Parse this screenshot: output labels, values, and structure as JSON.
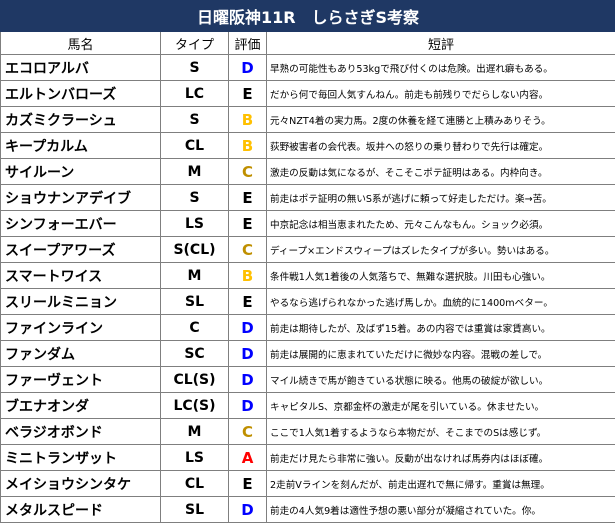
{
  "title": "日曜阪神11R　しらさぎS考察",
  "headers": {
    "name": "馬名",
    "type": "タイプ",
    "grade": "評価",
    "comment": "短評"
  },
  "grade_colors": {
    "A": "#ff0000",
    "B": "#ffc000",
    "C": "#bf8f00",
    "D": "#0000ff",
    "E": "#000000"
  },
  "rows": [
    {
      "name": "エコロアルバ",
      "type": "S",
      "grade": "D",
      "comment": "早熟の可能性もあり53kgで飛び付くのは危険。出遅れ癖もある。"
    },
    {
      "name": "エルトンバローズ",
      "type": "LC",
      "grade": "E",
      "comment": "だから何で毎回人気すんねん。前走も前残りでだらしない内容。"
    },
    {
      "name": "カズミクラーシュ",
      "type": "S",
      "grade": "B",
      "comment": "元々NZT4着の実力馬。2度の休養を経て連勝と上積みありそう。"
    },
    {
      "name": "キープカルム",
      "type": "CL",
      "grade": "B",
      "comment": "荻野被害者の会代表。坂井への怒りの乗り替わりで先行は確定。"
    },
    {
      "name": "サイルーン",
      "type": "M",
      "grade": "C",
      "comment": "激走の反動は気になるが、そこそこポテ証明はある。内枠向き。"
    },
    {
      "name": "ショウナンアデイブ",
      "type": "S",
      "grade": "E",
      "comment": "前走はポテ証明の無いS系が逃げに頼って好走しただけ。楽→苦。"
    },
    {
      "name": "シンフォーエバー",
      "type": "LS",
      "grade": "E",
      "comment": "中京記念は相当恵まれたため、元々こんなもん。ショック必須。"
    },
    {
      "name": "スイープアワーズ",
      "type": "S(CL)",
      "grade": "C",
      "comment": "ディープ×エンドスウィープはズレたタイプが多い。勢いはある。"
    },
    {
      "name": "スマートワイス",
      "type": "M",
      "grade": "B",
      "comment": "条件戦1人気1着後の人気落ちで、無難な選択肢。川田も心強い。"
    },
    {
      "name": "スリールミニョン",
      "type": "SL",
      "grade": "E",
      "comment": "やるなら逃げられなかった逃げ馬しか。血統的に1400mベター。"
    },
    {
      "name": "ファインライン",
      "type": "C",
      "grade": "D",
      "comment": "前走は期待したが、及ばず15着。あの内容では重賞は家賃高い。"
    },
    {
      "name": "ファンダム",
      "type": "SC",
      "grade": "D",
      "comment": "前走は展開的に恵まれていただけに微妙な内容。混戦の差しで。"
    },
    {
      "name": "ファーヴェント",
      "type": "CL(S)",
      "grade": "D",
      "comment": "マイル続きで馬が飽きている状態に映る。他馬の破綻が欲しい。"
    },
    {
      "name": "ブエナオンダ",
      "type": "LC(S)",
      "grade": "D",
      "comment": "キャピタルS、京都金杯の激走が尾を引いている。休ませたい。"
    },
    {
      "name": "ベラジオボンド",
      "type": "M",
      "grade": "C",
      "comment": "ここで1人気1着するようなら本物だが、そこまでのSは感じず。"
    },
    {
      "name": "ミニトランザット",
      "type": "LS",
      "grade": "A",
      "comment": "前走だけ見たら非常に強い。反動が出なければ馬券内はほぼ確。"
    },
    {
      "name": "メイショウシンタケ",
      "type": "CL",
      "grade": "E",
      "comment": "2走前Vラインを刻んだが、前走出遅れで無に帰す。重賞は無理。"
    },
    {
      "name": "メタルスピード",
      "type": "SL",
      "grade": "D",
      "comment": "前走の4人気9着は適性予想の悪い部分が凝縮されていた。你。"
    }
  ]
}
